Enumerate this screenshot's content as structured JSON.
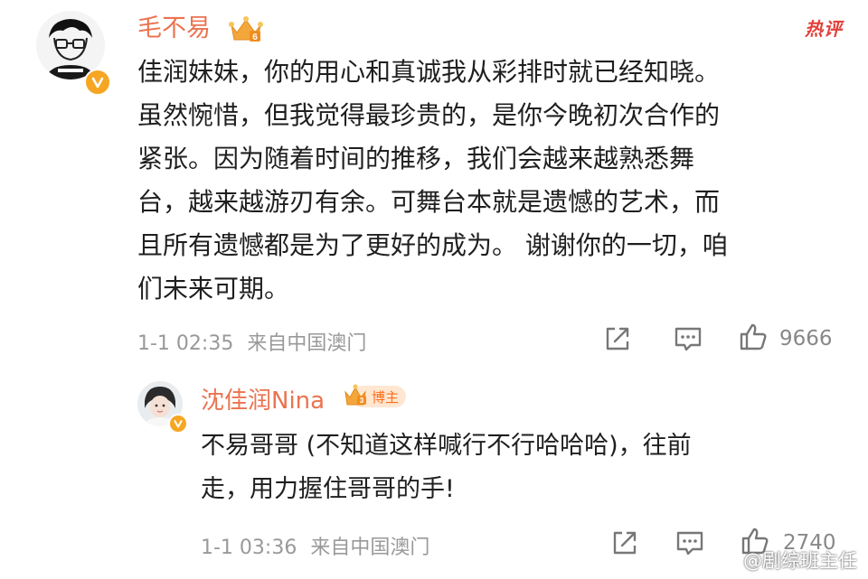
{
  "hot_tag": "热评",
  "main_comment": {
    "author": "毛不易",
    "lines": [
      "佳润妹妹，你的用心和真诚我从彩排时就已经知晓。",
      "虽然惋惜，但我觉得最珍贵的，是你今晚初次合作的",
      "紧张。因为随着时间的推移，我们会越来越熟悉舞",
      "台，越来越游刃有余。可舞台本就是遗憾的艺术，而",
      "且所有遗憾都是为了更好的成为。 谢谢你的一切，咱",
      "们未来可期。"
    ],
    "timestamp": "1-1 02:35",
    "source": "来自中国澳门",
    "likes": "9666"
  },
  "reply": {
    "author": "沈佳润Nina",
    "badge_label": "博主",
    "lines": [
      "不易哥哥 (不知道这样喊行不行哈哈哈)，往前",
      "走，用力握住哥哥的手!"
    ],
    "timestamp": "1-1 03:36",
    "source": "来自中国澳门",
    "likes": "2740"
  },
  "watermark": "@剧综班主任",
  "colors": {
    "name": "#eb7350",
    "hot": "#e2413a",
    "meta": "#999999",
    "verify": "#f6a623"
  }
}
